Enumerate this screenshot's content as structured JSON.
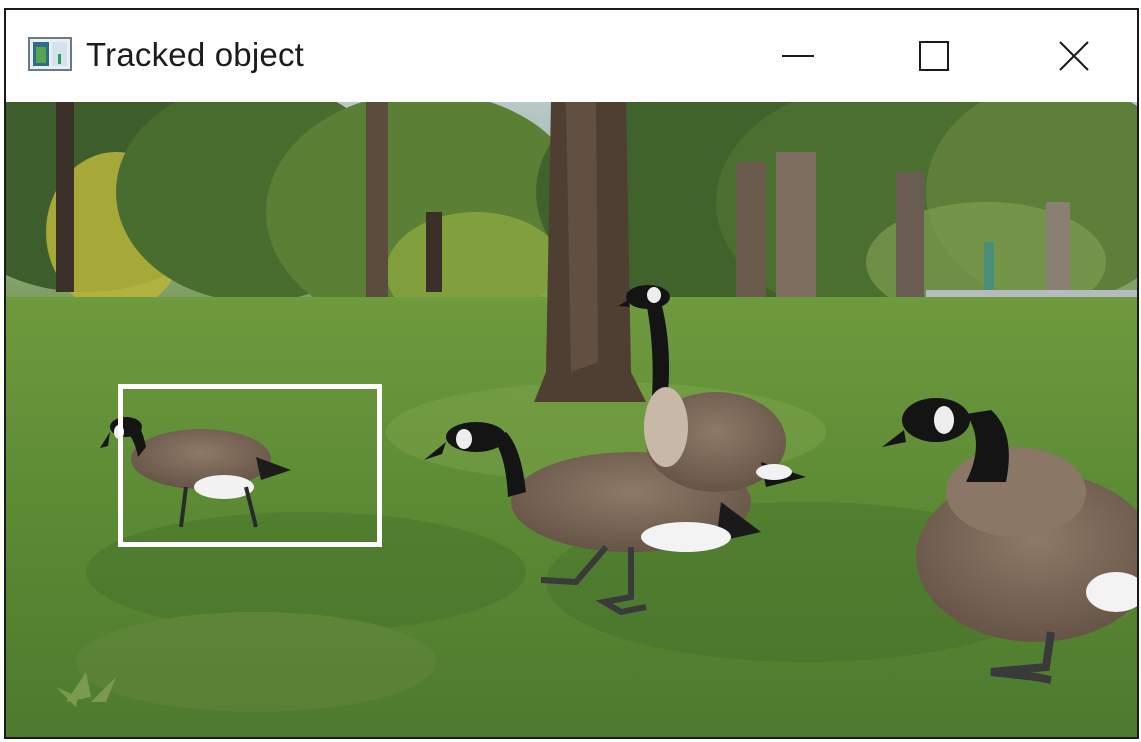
{
  "window": {
    "title": "Tracked object",
    "icon": "app-window-icon",
    "controls": {
      "minimize_icon": "minimize-icon",
      "maximize_icon": "maximize-icon",
      "close_icon": "close-icon"
    }
  },
  "frame": {
    "tracking_box": {
      "color": "#ffffff"
    },
    "colors": {
      "grass": "#5f8a38",
      "foliage": "#3f6a2a",
      "trunk": "#5a4636",
      "goose_body": "#7d6a5a",
      "goose_neck": "#141414"
    }
  }
}
